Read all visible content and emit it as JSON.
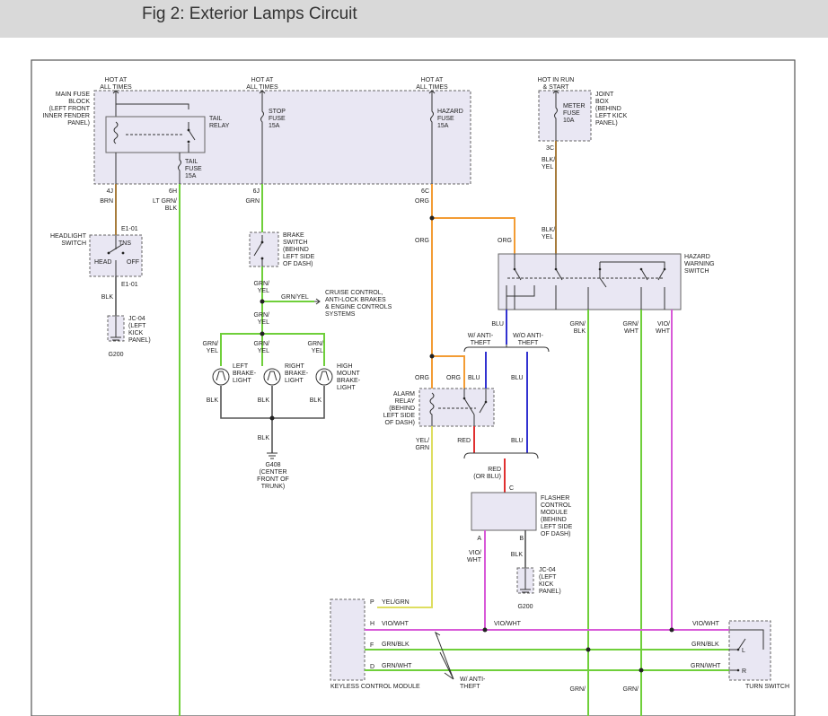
{
  "title": "Fig 2: Exterior Lamps Circuit",
  "colors": {
    "orange": "#f39c34",
    "green": "#6fcf3a",
    "gray": "#555555",
    "violet": "#d85ad8",
    "blue": "#3232d0",
    "red": "#e03030",
    "yellow": "#dede60",
    "brown": "#a77c3c",
    "box": "#e9e7f3"
  },
  "fuse_block": {
    "label": [
      "MAIN FUSE",
      "BLOCK",
      "(LEFT FRONT",
      "INNER FENDER",
      "PANEL)"
    ],
    "hot1": [
      "HOT AT",
      "ALL TIMES"
    ],
    "hot2": [
      "HOT AT",
      "ALL TIMES"
    ],
    "hot3": [
      "HOT AT",
      "ALL TIMES"
    ],
    "tail_relay": [
      "TAIL",
      "RELAY"
    ],
    "tail_fuse": [
      "TAIL",
      "FUSE",
      "15A"
    ],
    "stop_fuse": [
      "STOP",
      "FUSE",
      "15A"
    ],
    "hazard_fuse": [
      "HAZARD",
      "FUSE",
      "15A"
    ]
  },
  "joint_box": {
    "hot": [
      "HOT IN RUN",
      "& START"
    ],
    "label": [
      "JOINT",
      "BOX",
      "(BEHIND",
      "LEFT KICK",
      "PANEL)"
    ],
    "fuse": [
      "METER",
      "FUSE",
      "10A"
    ]
  },
  "pins": {
    "p4j": "4J",
    "p6h": "6H",
    "p6j": "6J",
    "p6c": "6C",
    "p3c": "3C",
    "e1": "E1-01",
    "e1b": "E1-01",
    "a": "A",
    "b": "B",
    "c": "C",
    "p": "P",
    "h": "H",
    "f": "F",
    "d": "D",
    "l": "L",
    "r": "R"
  },
  "wire_labels": {
    "brn": "BRN",
    "ltgrnblk": [
      "LT GRN/",
      "BLK"
    ],
    "grn": "GRN",
    "org1": "ORG",
    "org2": "ORG",
    "org3": "ORG",
    "org4": "ORG",
    "org5": "ORG",
    "blkyel1": [
      "BLK/",
      "YEL"
    ],
    "blkyel2": [
      "BLK/",
      "YEL"
    ],
    "blk1": "BLK",
    "grnyel1": [
      "GRN/",
      "YEL"
    ],
    "grnyel_mid": "GRN/YEL",
    "grnyel2": [
      "GRN/",
      "YEL"
    ],
    "grnyel3": [
      "GRN/",
      "YEL"
    ],
    "grnyel4": [
      "GRN/",
      "YEL"
    ],
    "grnyel5": [
      "GRN/",
      "YEL"
    ],
    "blk2": "BLK",
    "blk3": "BLK",
    "blk4": "BLK",
    "blk5": "BLK",
    "blu1": "BLU",
    "blu2": "BLU",
    "blu3": "BLU",
    "blu4": "BLU",
    "grnblk_v": [
      "GRN/",
      "BLK"
    ],
    "grnwht_v": [
      "GRN/",
      "WHT"
    ],
    "viowht_v": [
      "VIO/",
      "WHT"
    ],
    "yelgrn_v": [
      "YEL/",
      "GRN"
    ],
    "red": "RED",
    "red_or_blu": [
      "RED",
      "(OR BLU)"
    ],
    "viowht_a": [
      "VIO/",
      "WHT"
    ],
    "blk6": "BLK",
    "yelgrn_h": "YEL/GRN",
    "viowht_h1": "VIO/WHT",
    "viowht_h2": "VIO/WHT",
    "viowht_h3": "VIO/WHT",
    "grnblk_h1": "GRN/BLK",
    "grnblk_h2": "GRN/BLK",
    "grnwht_h1": "GRN/WHT",
    "grnwht_h2": "GRN/WHT",
    "grn_bot1": "GRN/",
    "grn_bot2": "GRN/"
  },
  "components": {
    "headlight_switch": [
      "HEADLIGHT",
      "SWITCH"
    ],
    "tns": "TNS",
    "head": "HEAD",
    "off": "OFF",
    "jc04a": [
      "JC-04",
      "(LEFT",
      "KICK",
      "PANEL)"
    ],
    "g200a": "G200",
    "brake_switch": [
      "BRAKE",
      "SWITCH",
      "(BEHIND",
      "LEFT SIDE",
      "OF DASH)"
    ],
    "cruise": [
      "CRUISE CONTROL,",
      "ANTI-LOCK BRAKES",
      "& ENGINE CONTROLS",
      "SYSTEMS"
    ],
    "left_brake": [
      "LEFT",
      "BRAKE-",
      "LIGHT"
    ],
    "right_brake": [
      "RIGHT",
      "BRAKE-",
      "LIGHT"
    ],
    "high_mount": [
      "HIGH",
      "MOUNT",
      "BRAKE-",
      "LIGHT"
    ],
    "g408": [
      "G408",
      "(CENTER",
      "FRONT OF",
      "TRUNK)"
    ],
    "hazard_switch": [
      "HAZARD",
      "WARNING",
      "SWITCH"
    ],
    "w_anti": [
      "W/ ANTI-",
      "THEFT"
    ],
    "wo_anti": [
      "W/O ANTI-",
      "THEFT"
    ],
    "alarm_relay": [
      "ALARM",
      "RELAY",
      "(BEHIND",
      "LEFT SIDE",
      "OF DASH)"
    ],
    "flasher": [
      "FLASHER",
      "CONTROL",
      "MODULE",
      "(BEHIND",
      "LEFT SIDE",
      "OF DASH)"
    ],
    "jc04b": [
      "JC-04",
      "(LEFT",
      "KICK",
      "PANEL)"
    ],
    "g200b": "G200",
    "keyless": "KEYLESS CONTROL MODULE",
    "w_anti2": [
      "W/ ANTI-",
      "THEFT"
    ],
    "turn": "TURN SWITCH"
  }
}
